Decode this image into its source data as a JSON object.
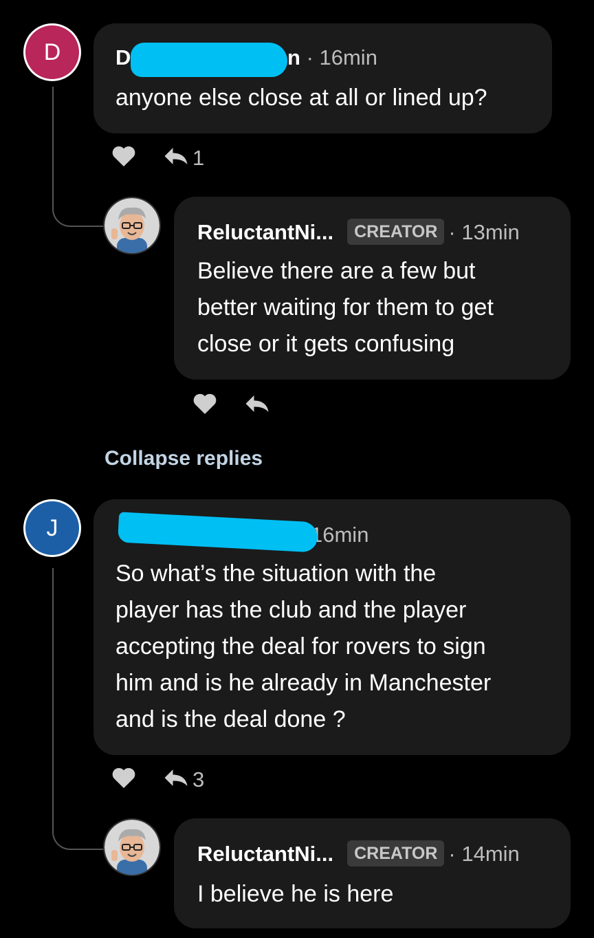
{
  "comments": [
    {
      "avatar_letter": "D",
      "avatar_color": "#b8265a",
      "author_visible": "D",
      "author_suffix": "n",
      "time": "· 16min",
      "text": "anyone else close at all or lined up?",
      "reply_count": "1",
      "replies": [
        {
          "author": "ReluctantNi...",
          "badge": "CREATOR",
          "time": "· 13min",
          "lines": [
            "Believe there are a few but",
            "better waiting for them to get",
            "close or it gets confusing"
          ]
        }
      ]
    },
    {
      "avatar_letter": "J",
      "avatar_color": "#1d5fa6",
      "time": "16min",
      "lines": [
        "So what’s the situation with the",
        "player has the club and the player",
        "accepting the deal for rovers to sign",
        "him and is he already in Manchester",
        "and is the deal done ?"
      ],
      "reply_count": "3",
      "replies": [
        {
          "author": "ReluctantNi...",
          "badge": "CREATOR",
          "time": "· 14min",
          "lines": [
            "I believe he is here"
          ]
        }
      ]
    }
  ],
  "collapse_label": "Collapse replies",
  "colors": {
    "redaction": "#00bff3",
    "bubble": "#1b1b1b",
    "link": "#c3d4e4"
  },
  "icons": [
    "heart-icon",
    "reply-icon"
  ]
}
